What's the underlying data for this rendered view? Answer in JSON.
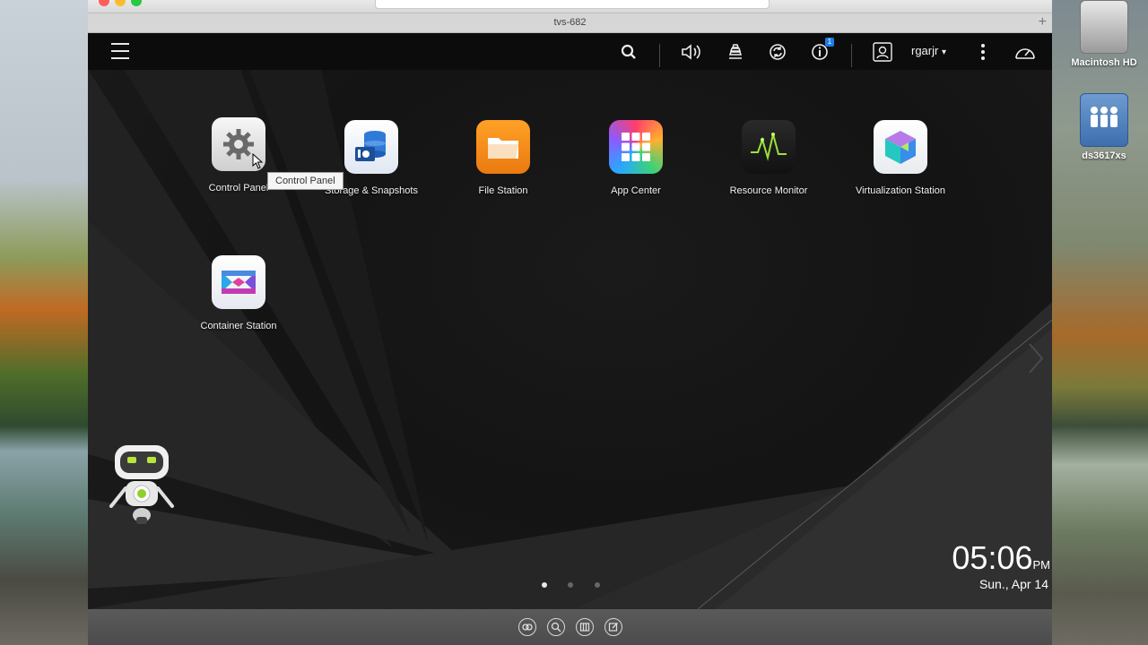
{
  "browser": {
    "title": "tvs-682",
    "new_tab": "+"
  },
  "topbar": {
    "user": "rgarjr",
    "user_caret": "▾",
    "notification_count": "1"
  },
  "apps": [
    {
      "label": "Control Panel"
    },
    {
      "label": "Storage & Snapshots"
    },
    {
      "label": "File Station"
    },
    {
      "label": "App Center"
    },
    {
      "label": "Resource Monitor"
    },
    {
      "label": "Virtualization Station"
    },
    {
      "label": "Container Station"
    }
  ],
  "tooltip": "Control Panel",
  "clock": {
    "time": "05:06",
    "ampm": "PM",
    "date": "Sun., Apr 14"
  },
  "pager": {
    "pages": 3,
    "active": 1
  },
  "desktop_icons": [
    {
      "label": "Macintosh HD"
    },
    {
      "label": "ds3617xs"
    }
  ],
  "colors": {
    "accent": "#1e7be8",
    "file_station": "#f08a1c",
    "topbar": "#0c0c0c"
  }
}
